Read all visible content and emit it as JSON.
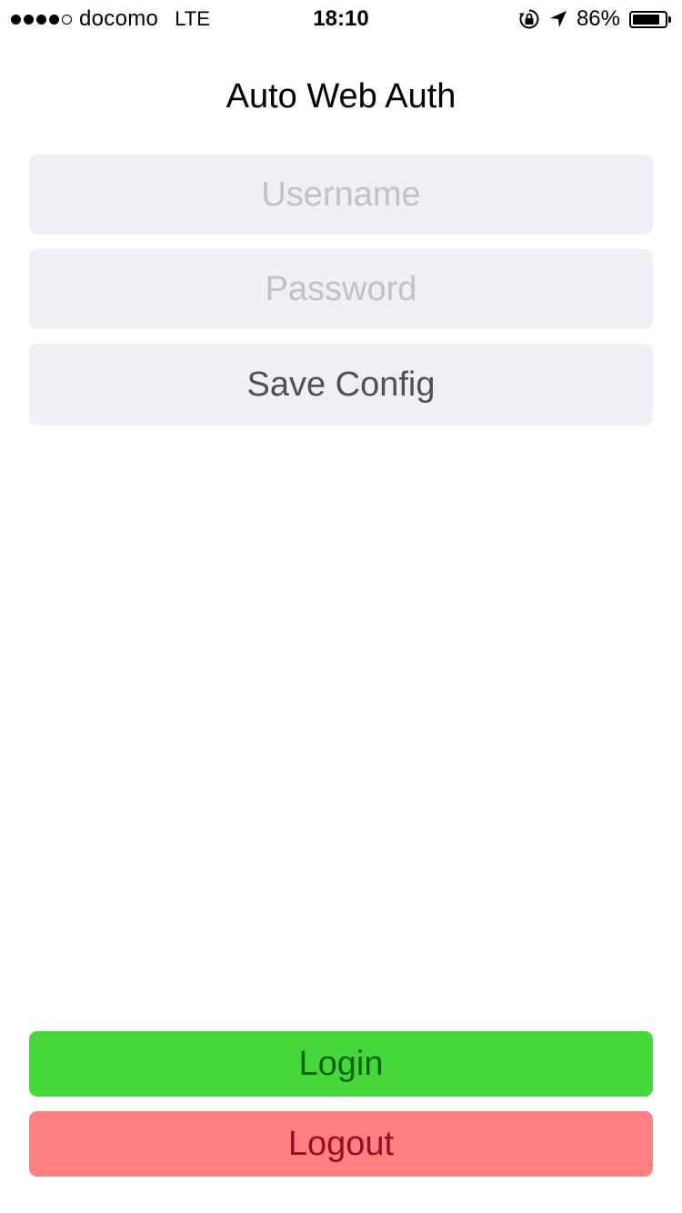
{
  "status_bar": {
    "signal_bars_filled": 4,
    "signal_bars_total": 5,
    "carrier": "docomo",
    "network": "LTE",
    "time": "18:10",
    "icons": [
      "rotation-lock-icon",
      "location-arrow-icon",
      "battery-icon"
    ],
    "battery_percent_label": "86%",
    "battery_level": 0.86
  },
  "header": {
    "title": "Auto Web Auth"
  },
  "form": {
    "username_placeholder": "Username",
    "username_value": "",
    "password_placeholder": "Password",
    "password_value": "",
    "save_label": "Save Config"
  },
  "actions": {
    "login_label": "Login",
    "logout_label": "Logout"
  },
  "colors": {
    "field_background": "#efeff4",
    "login_background": "#44d83a",
    "login_text": "#0a650a",
    "logout_background": "#ff8080",
    "logout_text": "#9c0c24"
  }
}
